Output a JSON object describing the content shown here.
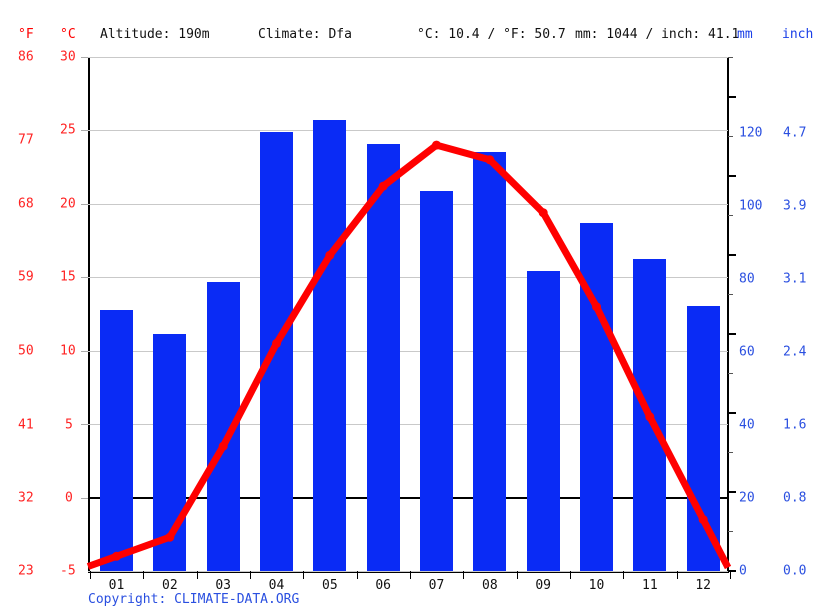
{
  "header": {
    "left_unit_f": "°F",
    "left_unit_c": "°C",
    "altitude": "Altitude: 190m",
    "climate": "Climate: Dfa",
    "temp_summary": "°C: 10.4 / °F: 50.7",
    "precip_summary": "mm: 1044 / inch: 41.1",
    "right_unit_mm": "mm",
    "right_unit_inch": "inch"
  },
  "footer": {
    "copyright": "Copyright: CLIMATE-DATA.ORG"
  },
  "axes": {
    "fahrenheit_ticks": [
      "86",
      "77",
      "68",
      "59",
      "50",
      "41",
      "32",
      "23"
    ],
    "celsius_ticks": [
      "30",
      "25",
      "20",
      "15",
      "10",
      "5",
      "0",
      "-5"
    ],
    "mm_ticks": [
      "120",
      "100",
      "80",
      "60",
      "40",
      "20",
      "0"
    ],
    "inch_ticks": [
      "4.7",
      "3.9",
      "3.1",
      "2.4",
      "1.6",
      "0.8",
      "0.0"
    ]
  },
  "colors": {
    "temperature": "#ff0000",
    "precipitation": "#0a2bf5",
    "grid": "#c9c9c9",
    "axis": "#000000"
  },
  "chart_data": {
    "type": "bar",
    "title": "",
    "subtitle": "",
    "xlabel": "",
    "ylabel": "",
    "grid": true,
    "legend_position": "none",
    "categories": [
      "01",
      "02",
      "03",
      "04",
      "05",
      "06",
      "07",
      "08",
      "09",
      "10",
      "11",
      "12"
    ],
    "series": [
      {
        "name": "Precipitation",
        "type": "bar",
        "unit": "mm",
        "axis": "right",
        "color": "#0a2bf5",
        "values": [
          66,
          60,
          73,
          111,
          114,
          108,
          96,
          106,
          76,
          88,
          79,
          67
        ]
      },
      {
        "name": "Temperature",
        "type": "line",
        "unit": "°C",
        "axis": "left",
        "color": "#ff0000",
        "values": [
          -4.0,
          -2.7,
          3.5,
          10.5,
          16.5,
          21.2,
          24.0,
          23.0,
          19.4,
          13.0,
          5.5,
          -1.5
        ]
      }
    ],
    "ylim_left_c": [
      -5,
      30
    ],
    "ylim_left_f": [
      23,
      86
    ],
    "ylim_right_mm": [
      0,
      130
    ],
    "ylim_right_inch": [
      0.0,
      5.1
    ],
    "annotations": {
      "altitude": "190m",
      "climate_class": "Dfa",
      "avg_temp_c": 10.4,
      "avg_temp_f": 50.7,
      "total_precip_mm": 1044,
      "total_precip_inch": 41.1
    }
  }
}
